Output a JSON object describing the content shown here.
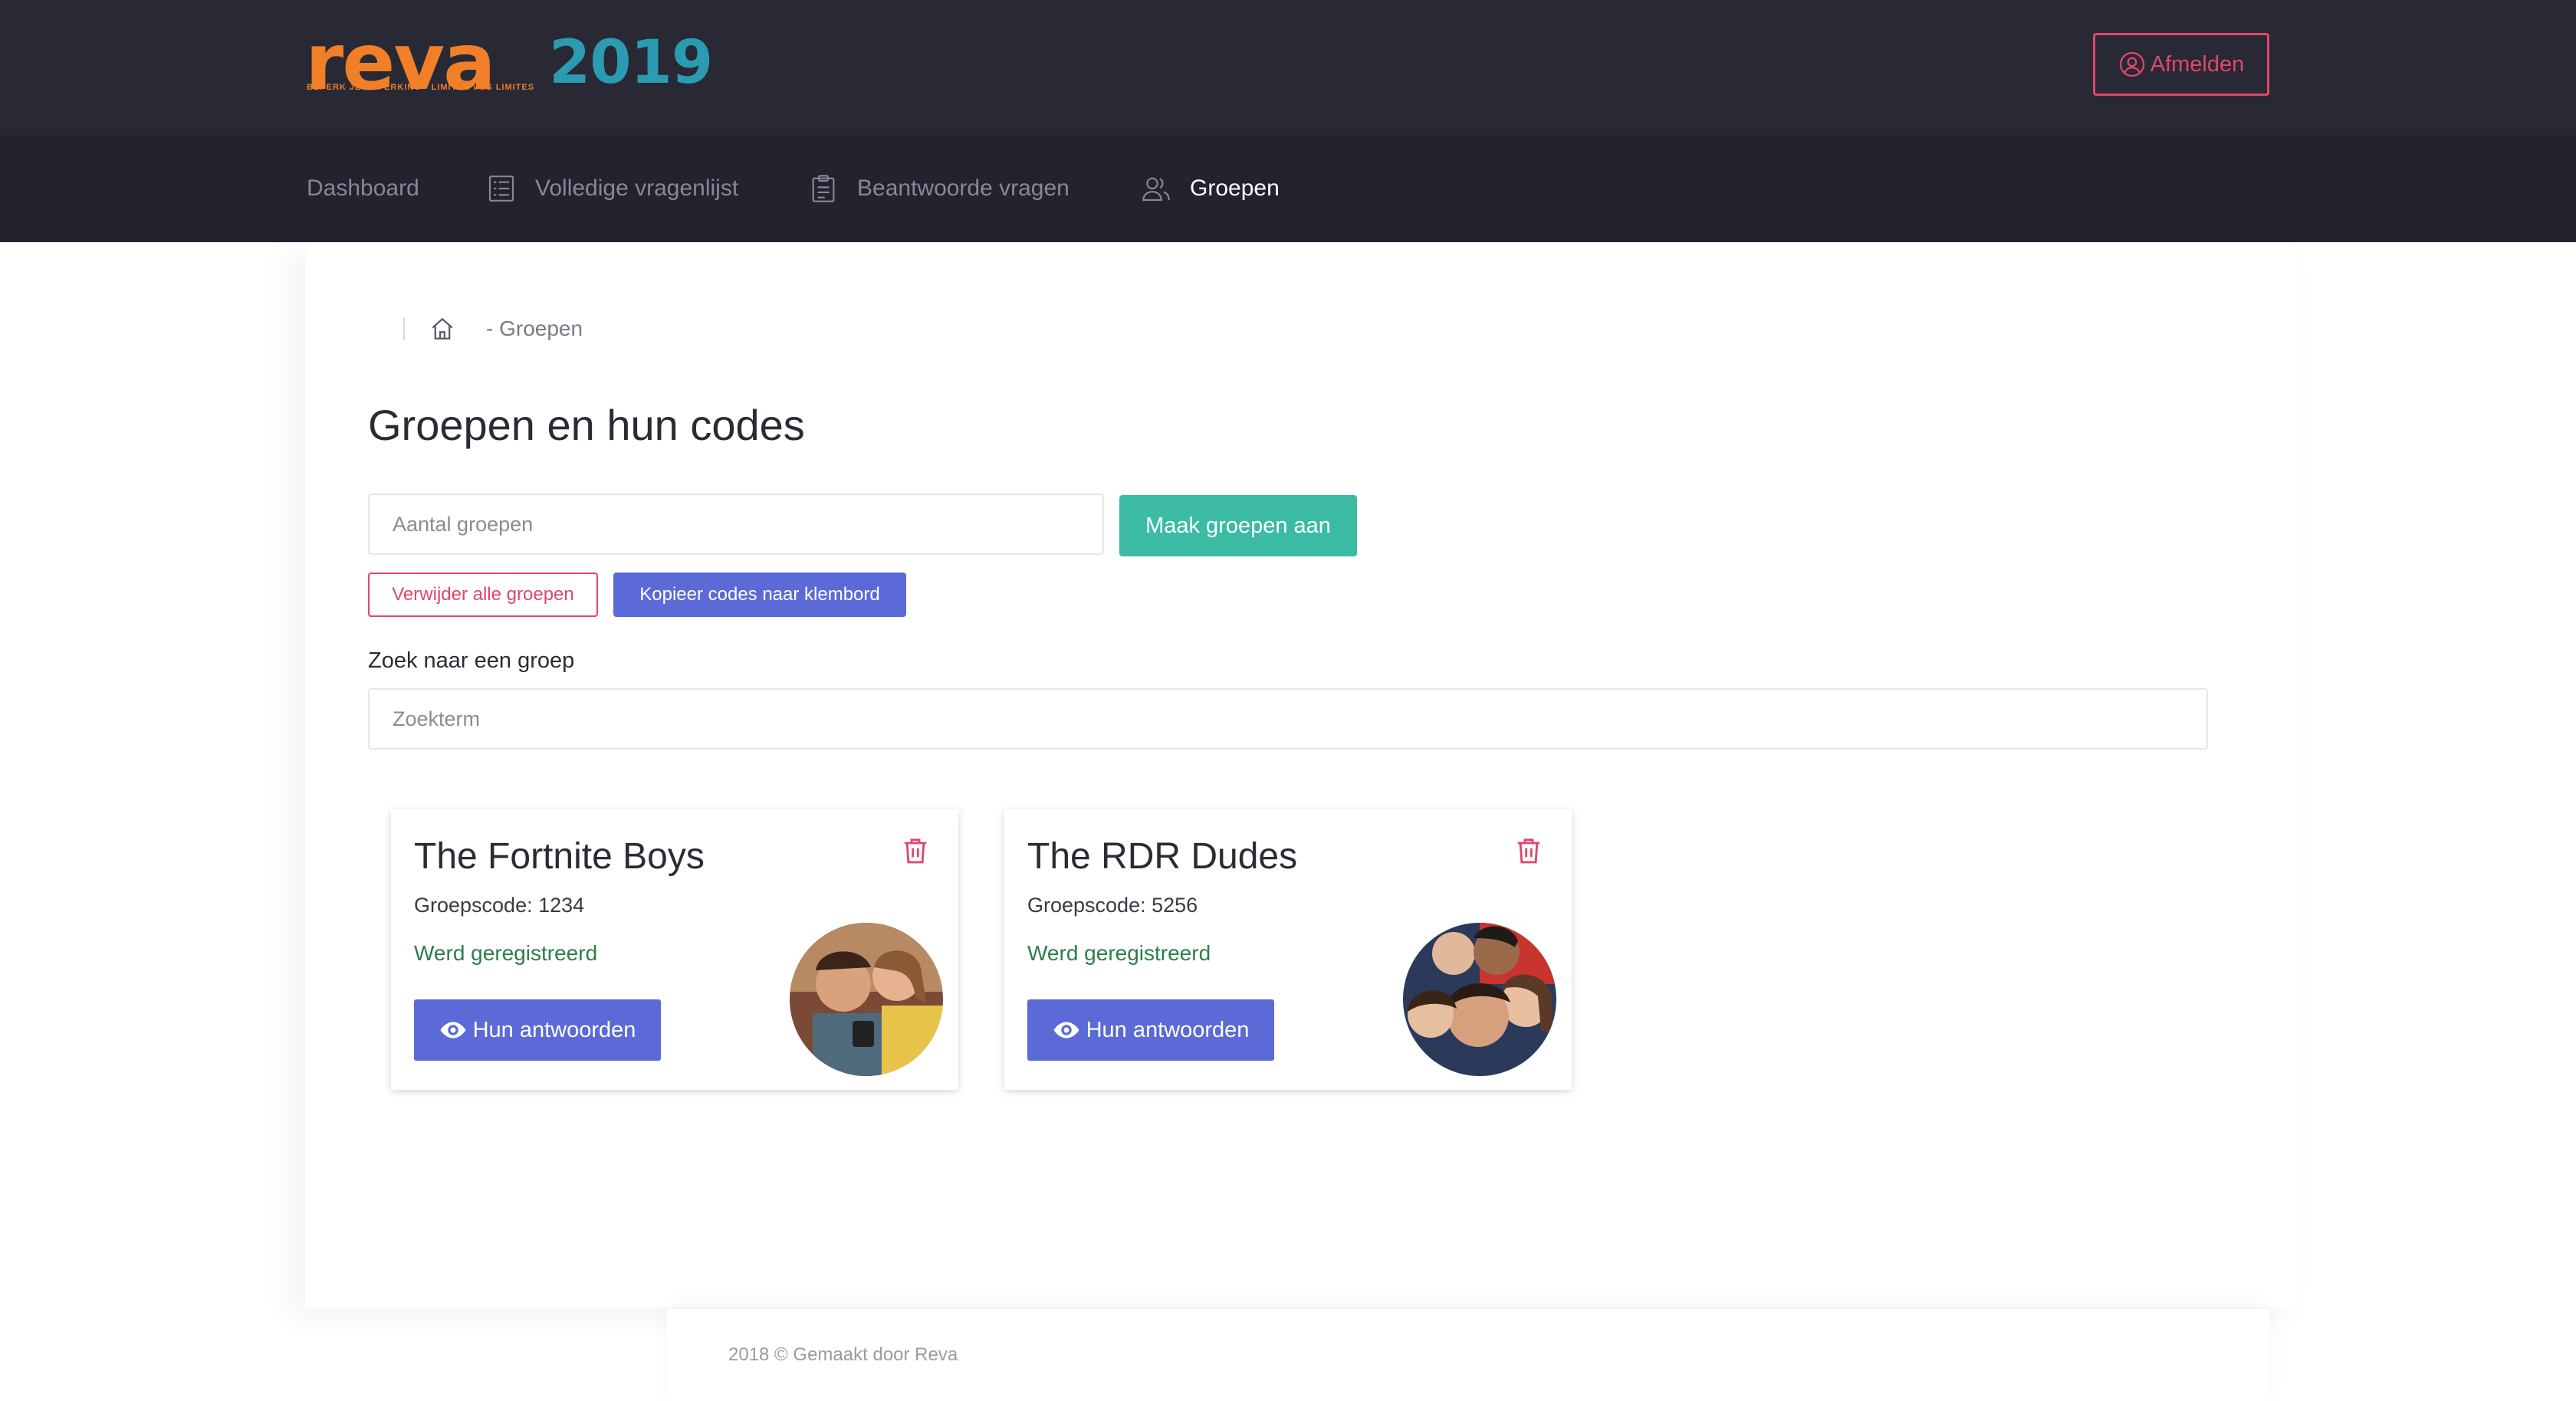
{
  "header": {
    "logo": {
      "word": "reva",
      "year": "2019",
      "tagline": "BEPERK JE BEPERKING - LIMITEZ VOS LIMITES"
    },
    "logout_label": "Afmelden"
  },
  "nav": {
    "items": [
      {
        "label": "Dashboard",
        "icon": "none",
        "active": false
      },
      {
        "label": "Volledige vragenlijst",
        "icon": "list-icon",
        "active": false
      },
      {
        "label": "Beantwoorde vragen",
        "icon": "clipboard-icon",
        "active": false
      },
      {
        "label": "Groepen",
        "icon": "users-icon",
        "active": true
      }
    ]
  },
  "breadcrumb": {
    "current": "- Groepen"
  },
  "page": {
    "title": "Groepen en hun codes",
    "count_placeholder": "Aantal groepen",
    "create_label": "Maak groepen aan",
    "delete_all_label": "Verwijder alle groepen",
    "copy_label": "Kopieer codes naar klembord",
    "search_label": "Zoek naar een groep",
    "search_placeholder": "Zoekterm"
  },
  "groups": [
    {
      "name": "The Fortnite Boys",
      "code": "Groepscode: 1234",
      "status": "Werd geregistreerd",
      "button": "Hun antwoorden"
    },
    {
      "name": "The RDR Dudes",
      "code": "Groepscode: 5256",
      "status": "Werd geregistreerd",
      "button": "Hun antwoorden"
    }
  ],
  "footer": {
    "text": "2018 © Gemaakt door Reva"
  },
  "colors": {
    "header_bg": "#282935",
    "nav_bg": "#22232e",
    "accent_orange": "#f07f27",
    "accent_teal": "#2a9bb1",
    "danger": "#e0476a",
    "primary": "#5b6ad6",
    "success": "#3bbba4",
    "status_green": "#2e7d4a"
  }
}
